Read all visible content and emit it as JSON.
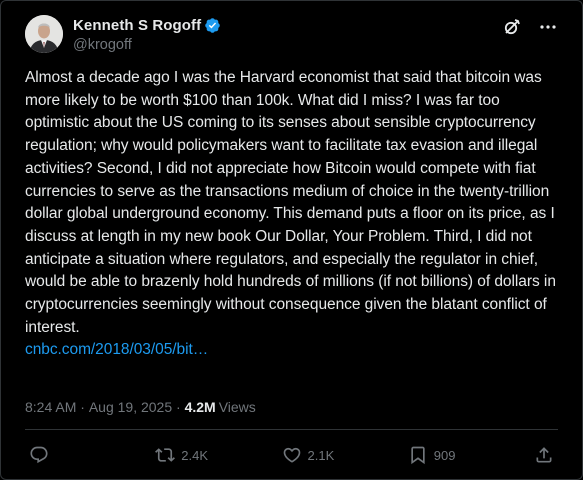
{
  "author": {
    "display_name": "Kenneth S Rogoff",
    "handle": "@krogoff",
    "verified_icon": "verified-badge-icon"
  },
  "header_actions": [
    "grok-icon",
    "more-icon"
  ],
  "post": {
    "text": "Almost a decade ago I was the Harvard economist that said that bitcoin was more likely to be worth $100 than 100k.  What did I miss? I was far too optimistic about the US coming to its senses about sensible cryptocurrency regulation; why would policymakers want to facilitate tax evasion and illegal activities?  Second, I did not appreciate how Bitcoin would compete with fiat currencies to serve as the transactions medium of choice in the twenty-trillion dollar global underground economy. This demand puts a floor on its price, as I discuss at length in my new book Our Dollar, Your Problem. Third, I did not anticipate a situation where regulators, and especially the regulator in chief, would be able to brazenly hold hundreds of millions (if not billions) of dollars in cryptocurrencies seemingly without consequence given the blatant conflict of interest.",
    "link": "cnbc.com/2018/03/05/bit…"
  },
  "meta": {
    "time": "8:24 AM",
    "separator": " · ",
    "date": "Aug 19, 2025",
    "views_count": "4.2M",
    "views_label": "Views"
  },
  "actions": {
    "reply_icon": "reply-icon",
    "retweets": "2.4K",
    "likes": "2.1K",
    "bookmarks": "909",
    "share_icon": "share-icon"
  },
  "colors": {
    "background": "#000000",
    "text": "#e7e9ea",
    "muted": "#71767b",
    "link": "#1d9bf0",
    "border": "#2f3336"
  }
}
